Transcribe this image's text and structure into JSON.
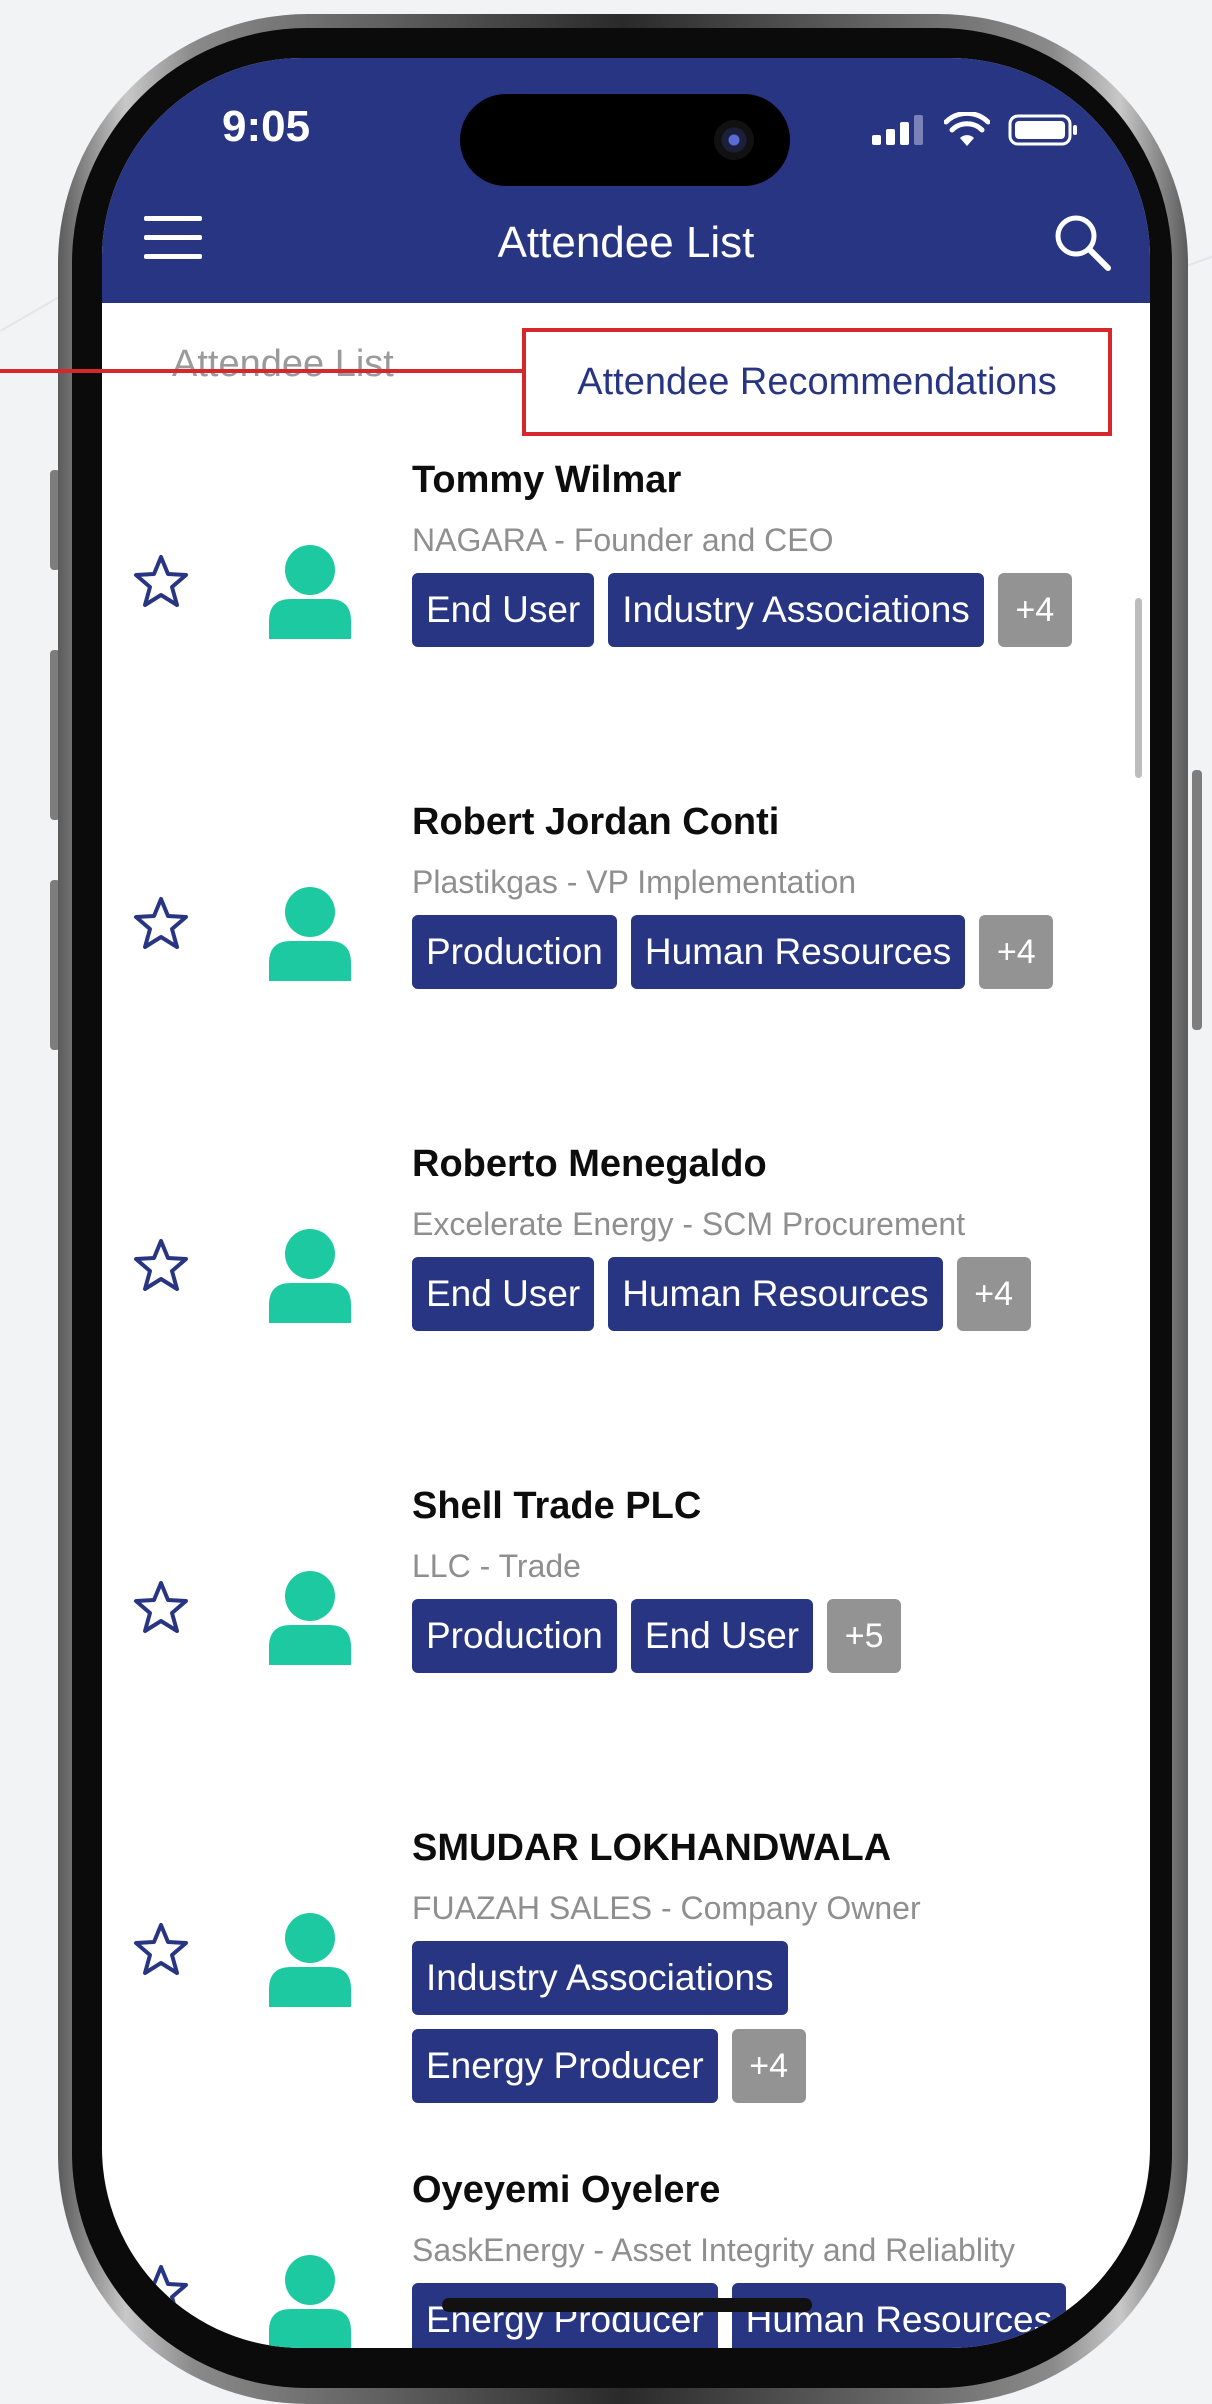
{
  "status_bar": {
    "time": "9:05"
  },
  "header": {
    "title": "Attendee List"
  },
  "tabs": [
    {
      "label": "Attendee List",
      "active": false
    },
    {
      "label": "Attendee Recommendations",
      "active": true
    }
  ],
  "colors": {
    "primary": "#283583",
    "accent_green": "#1dc9a0",
    "highlight": "#d6282b",
    "tag_more": "#939393"
  },
  "attendees": [
    {
      "name": "Tommy Wilmar",
      "company": "NAGARA - Founder and CEO",
      "tags": [
        "End User",
        "Industry Associations"
      ],
      "more": "+4"
    },
    {
      "name": "Robert Jordan Conti",
      "company": "Plastikgas - VP Implementation",
      "tags": [
        "Production",
        "Human Resources"
      ],
      "more": "+4"
    },
    {
      "name": "Roberto Menegaldo",
      "company": "Excelerate Energy - SCM Procurement",
      "tags": [
        "End User",
        "Human Resources"
      ],
      "more": "+4"
    },
    {
      "name": "Shell Trade PLC",
      "company": "LLC - Trade",
      "tags": [
        "Production",
        "End User"
      ],
      "more": "+5"
    },
    {
      "name": "SMUDAR LOKHANDWALA",
      "company": "FUAZAH SALES - Company Owner",
      "tags": [
        "Industry Associations",
        "Energy Producer"
      ],
      "more": "+4"
    },
    {
      "name": "Oyeyemi Oyelere",
      "company": "SaskEnergy - Asset Integrity and Reliablity",
      "tags": [
        "Energy Producer",
        "Human Resources"
      ],
      "more": ""
    }
  ]
}
